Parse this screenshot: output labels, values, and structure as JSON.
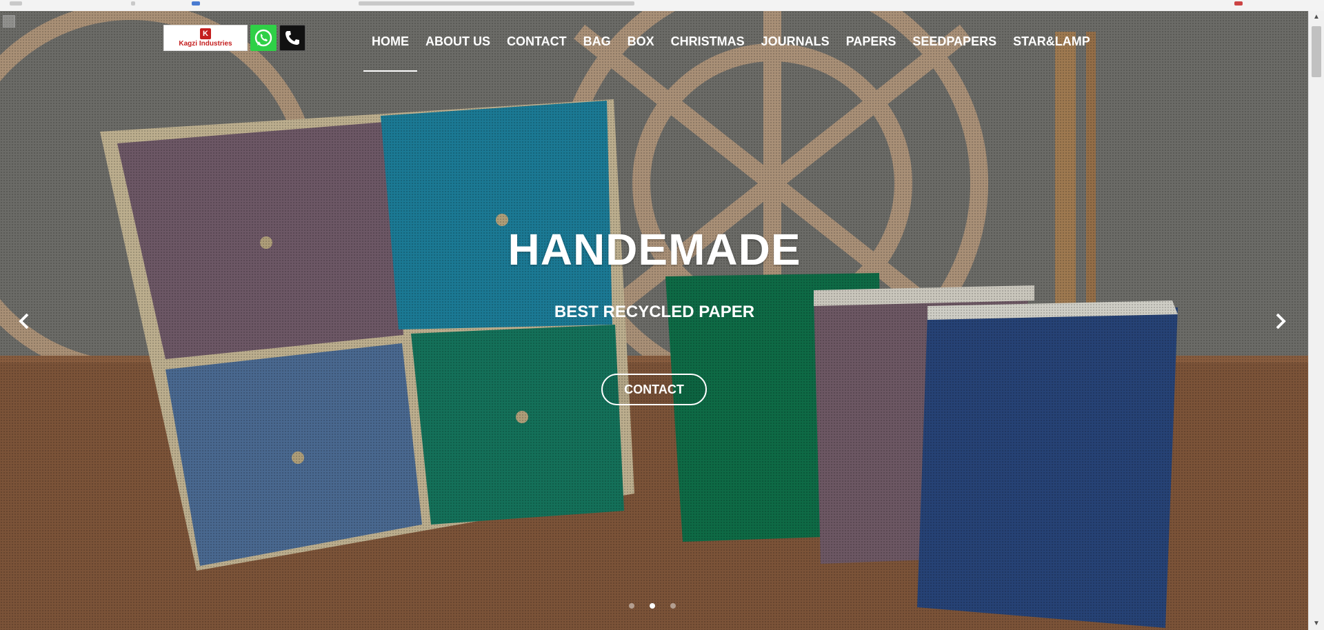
{
  "brand": {
    "logo_text": "Kagzi Industries",
    "logo_mark": "K",
    "whatsapp_icon": "whatsapp-icon",
    "phone_icon": "phone-icon"
  },
  "nav": {
    "items": [
      {
        "label": "HOME",
        "active": true
      },
      {
        "label": "ABOUT US"
      },
      {
        "label": "CONTACT"
      },
      {
        "label": "BAG"
      },
      {
        "label": "BOX"
      },
      {
        "label": "CHRISTMAS"
      },
      {
        "label": "JOURNALS"
      },
      {
        "label": "PAPERS"
      },
      {
        "label": "SEEDPAPERS"
      },
      {
        "label": "STAR&LAMP"
      }
    ]
  },
  "hero": {
    "title": "HANDEMADE",
    "subtitle": "BEST RECYCLED PAPER",
    "cta_label": "CONTACT",
    "prev_icon": "chevron-left-icon",
    "next_icon": "chevron-right-icon",
    "slides_total": 3,
    "active_slide": 2
  },
  "colors": {
    "whatsapp": "#2fd047",
    "logo_red": "#c41e1e",
    "text": "#ffffff"
  }
}
